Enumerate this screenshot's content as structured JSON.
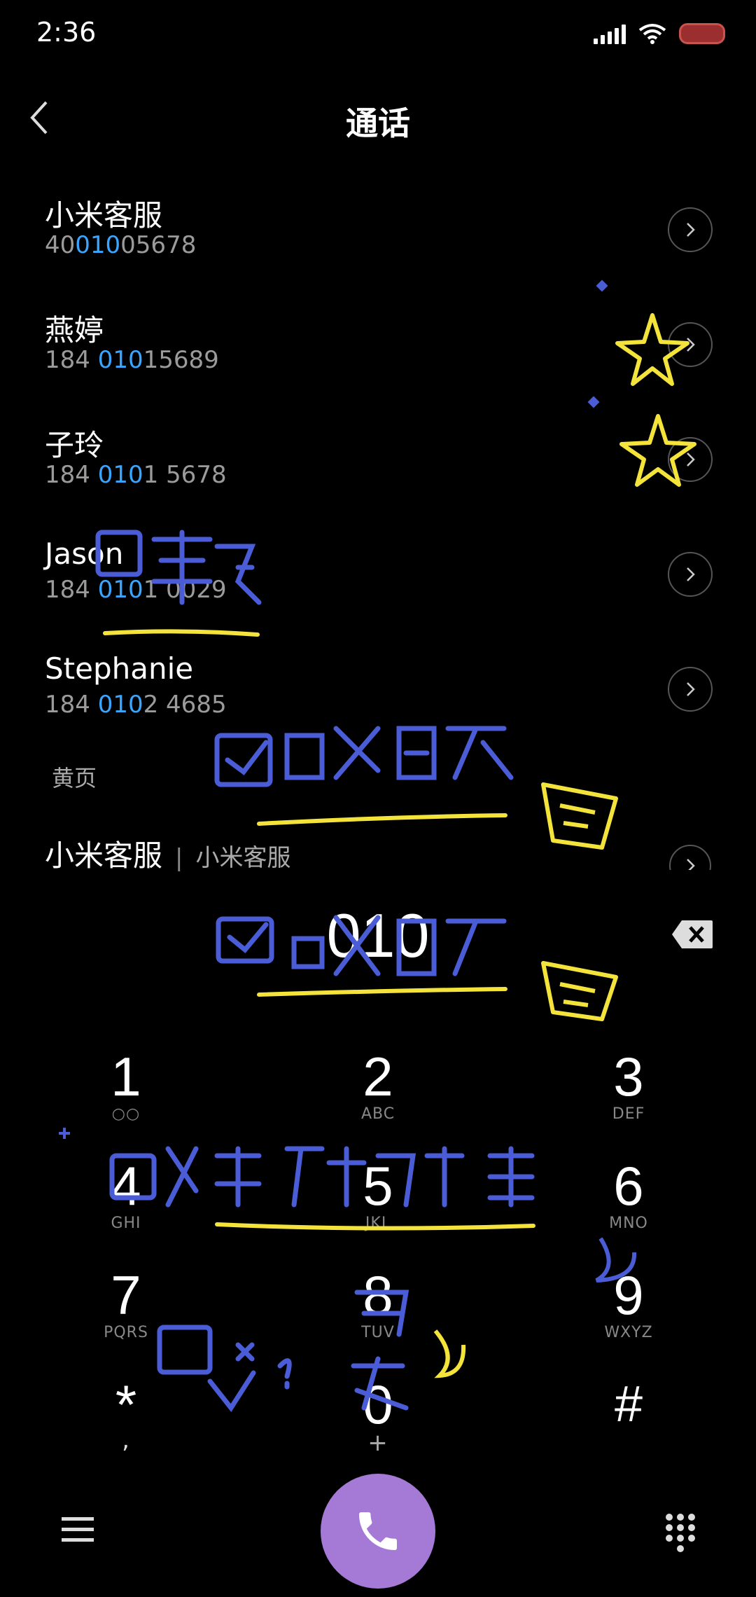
{
  "status": {
    "time": "2:36"
  },
  "header": {
    "title": "通话"
  },
  "contacts": [
    {
      "name": "小米客服",
      "num_pre": "40",
      "num_hl": "010",
      "num_post": "05678"
    },
    {
      "name": "燕婷",
      "num_pre": "184 ",
      "num_hl": "010",
      "num_post": "15689"
    },
    {
      "name": "子玲",
      "num_pre": "184 ",
      "num_hl": "010",
      "num_post": "1 5678"
    },
    {
      "name": "Jason",
      "num_pre": "184 ",
      "num_hl": "010",
      "num_post": "1 0029"
    },
    {
      "name": "Stephanie",
      "num_pre": "184 ",
      "num_hl": "010",
      "num_post": "2 4685"
    }
  ],
  "yellow_pages": {
    "label": "黄页",
    "item": {
      "name": "小米客服",
      "separator": "|",
      "subtitle": "小米客服"
    }
  },
  "dial": {
    "value": "010"
  },
  "keypad": [
    {
      "digit": "1",
      "letters": "○○"
    },
    {
      "digit": "2",
      "letters": "ABC"
    },
    {
      "digit": "3",
      "letters": "DEF"
    },
    {
      "digit": "4",
      "letters": "GHI"
    },
    {
      "digit": "5",
      "letters": "JKL"
    },
    {
      "digit": "6",
      "letters": "MNO"
    },
    {
      "digit": "7",
      "letters": "PQRS"
    },
    {
      "digit": "8",
      "letters": "TUV"
    },
    {
      "digit": "9",
      "letters": "WXYZ"
    },
    {
      "digit": "*",
      "letters": ","
    },
    {
      "digit": "0",
      "letters": "+"
    },
    {
      "digit": "#",
      "letters": ""
    }
  ],
  "colors": {
    "accent": "#3aa6ff",
    "call": "#a57ad6",
    "doodle_blue": "#4a5cd6",
    "doodle_yellow": "#f3e33b"
  }
}
